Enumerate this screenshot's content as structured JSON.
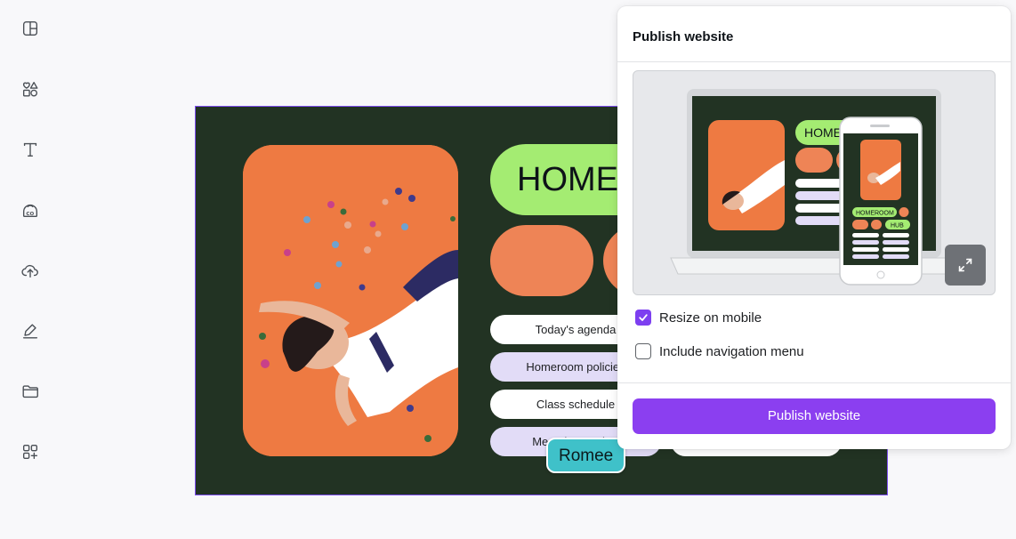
{
  "toolbar": {
    "items": [
      {
        "icon": "layout-icon"
      },
      {
        "icon": "elements-icon"
      },
      {
        "icon": "text-icon"
      },
      {
        "icon": "brand-icon"
      },
      {
        "icon": "uploads-icon"
      },
      {
        "icon": "draw-icon"
      },
      {
        "icon": "projects-icon"
      },
      {
        "icon": "apps-icon"
      }
    ]
  },
  "design": {
    "heading": "HOMEROOM",
    "buttons": [
      "Today's agenda",
      "Homeroom policies",
      "Class schedule",
      "Meet the teacher"
    ],
    "colors": {
      "background": "#223323",
      "accent_green": "#a4ec72",
      "accent_orange": "#ee8456",
      "lavender": "#e2dcf7"
    }
  },
  "collaborator": {
    "name": "Romee",
    "color": "#3fc1c9"
  },
  "panel": {
    "title": "Publish website",
    "options": [
      {
        "label": "Resize on mobile",
        "checked": true
      },
      {
        "label": "Include navigation menu",
        "checked": false
      }
    ],
    "publish_label": "Publish website",
    "accent": "#8b3ff0",
    "preview": {
      "mobile_heading": "HOMEROOM",
      "mobile_hub": "HUB",
      "desktop_heading": "HOME"
    }
  }
}
